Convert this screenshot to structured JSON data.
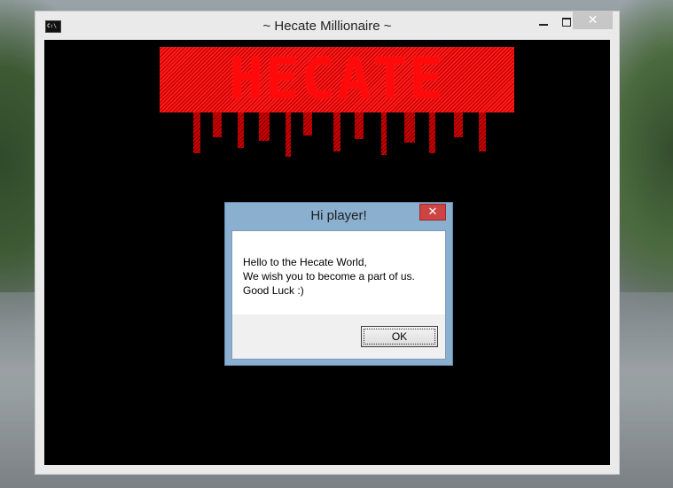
{
  "window": {
    "title": "~ Hecate Millionaire ~",
    "icon": "console-icon",
    "icon_text": "C:\\",
    "close_glyph": "✕"
  },
  "console": {
    "logo_text": "HECATE",
    "logo_color": "#ff0a0a",
    "background": "#000000"
  },
  "dialog": {
    "title": "Hi player!",
    "close_glyph": "✕",
    "lines": [
      "Hello to the Hecate World,",
      "We wish you to become a part of us.",
      "Good Luck :)"
    ],
    "ok_label": "OK"
  }
}
